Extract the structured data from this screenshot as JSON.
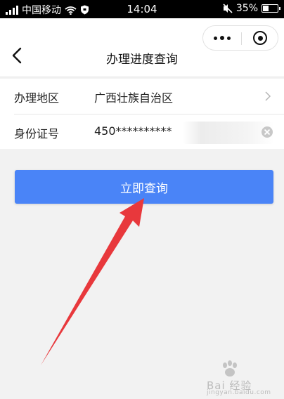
{
  "status_bar": {
    "carrier": "中国移动",
    "time": "14:04",
    "battery_percent": "35%",
    "battery_level": 0.35,
    "icons": [
      "signal-icon",
      "wifi-icon",
      "shield-icon",
      "mute-icon",
      "battery-icon"
    ]
  },
  "nav": {
    "title": "办理进度查询",
    "icons": [
      "back-icon",
      "more-icon",
      "close-icon"
    ]
  },
  "form": {
    "rows": [
      {
        "label": "办理地区",
        "value": "广西壮族自治区",
        "icon": "chevron-right-icon"
      },
      {
        "label": "身份证号",
        "value": "450**********",
        "icon": "clear-icon"
      }
    ]
  },
  "actions": {
    "query_label": "立即查询"
  },
  "annotation": {
    "arrow_color": "#e8383c",
    "icon": "arrow-annotation"
  },
  "watermark": {
    "brand": "Bai 经验",
    "site": "jingyan.baidu.com",
    "icon": "paw-icon"
  },
  "colors": {
    "primary": "#4a84f7",
    "background": "#f2f2f2",
    "status_bar": "#000000"
  }
}
